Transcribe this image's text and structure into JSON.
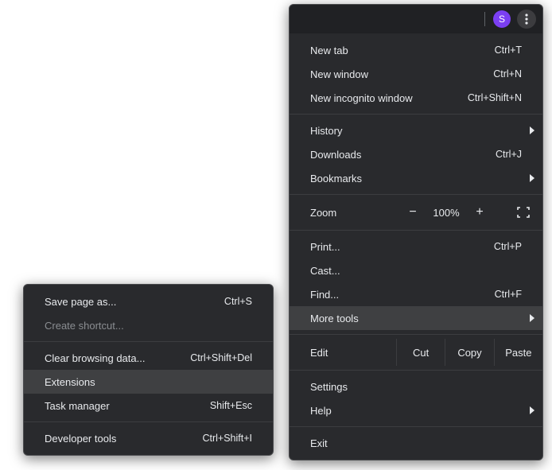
{
  "colors": {
    "avatar_bg": "#7b3ff2"
  },
  "topbar": {
    "avatar_initial": "S"
  },
  "main": {
    "new_tab": {
      "label": "New tab",
      "shortcut": "Ctrl+T"
    },
    "new_window": {
      "label": "New window",
      "shortcut": "Ctrl+N"
    },
    "incognito": {
      "label": "New incognito window",
      "shortcut": "Ctrl+Shift+N"
    },
    "history": {
      "label": "History"
    },
    "downloads": {
      "label": "Downloads",
      "shortcut": "Ctrl+J"
    },
    "bookmarks": {
      "label": "Bookmarks"
    },
    "zoom": {
      "label": "Zoom",
      "minus": "−",
      "value": "100%",
      "plus": "+"
    },
    "print": {
      "label": "Print...",
      "shortcut": "Ctrl+P"
    },
    "cast": {
      "label": "Cast..."
    },
    "find": {
      "label": "Find...",
      "shortcut": "Ctrl+F"
    },
    "more_tools": {
      "label": "More tools"
    },
    "edit": {
      "label": "Edit",
      "cut": "Cut",
      "copy": "Copy",
      "paste": "Paste"
    },
    "settings": {
      "label": "Settings"
    },
    "help": {
      "label": "Help"
    },
    "exit": {
      "label": "Exit"
    }
  },
  "sub": {
    "save_page": {
      "label": "Save page as...",
      "shortcut": "Ctrl+S"
    },
    "create_shortcut": {
      "label": "Create shortcut..."
    },
    "clear_data": {
      "label": "Clear browsing data...",
      "shortcut": "Ctrl+Shift+Del"
    },
    "extensions": {
      "label": "Extensions"
    },
    "task_manager": {
      "label": "Task manager",
      "shortcut": "Shift+Esc"
    },
    "dev_tools": {
      "label": "Developer tools",
      "shortcut": "Ctrl+Shift+I"
    }
  }
}
